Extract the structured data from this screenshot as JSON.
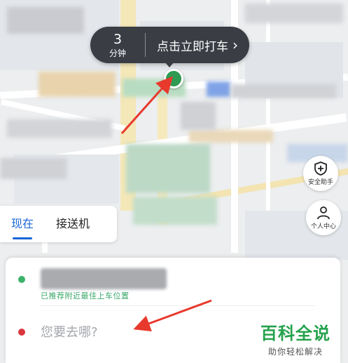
{
  "eta": {
    "number": "3",
    "unit": "分钟",
    "action": "点击立即打车",
    "chevron": "›"
  },
  "side": {
    "safety_label": "安全助手",
    "profile_label": "个人中心"
  },
  "tabs": [
    {
      "label": "现在",
      "active": true
    },
    {
      "label": "接送机",
      "active": false
    }
  ],
  "trip": {
    "from_hint": "已推荐附近最佳上车位置",
    "to_placeholder": "您要去哪?"
  },
  "watermark": {
    "title": "百科全说",
    "subtitle": "助你轻松解决"
  },
  "colors": {
    "accent": "#1a66d6",
    "pickup_dot": "#3bb26b",
    "dest_dot": "#d9363e",
    "pill_bg": "#3a3d44",
    "arrow": "#e8392d"
  }
}
